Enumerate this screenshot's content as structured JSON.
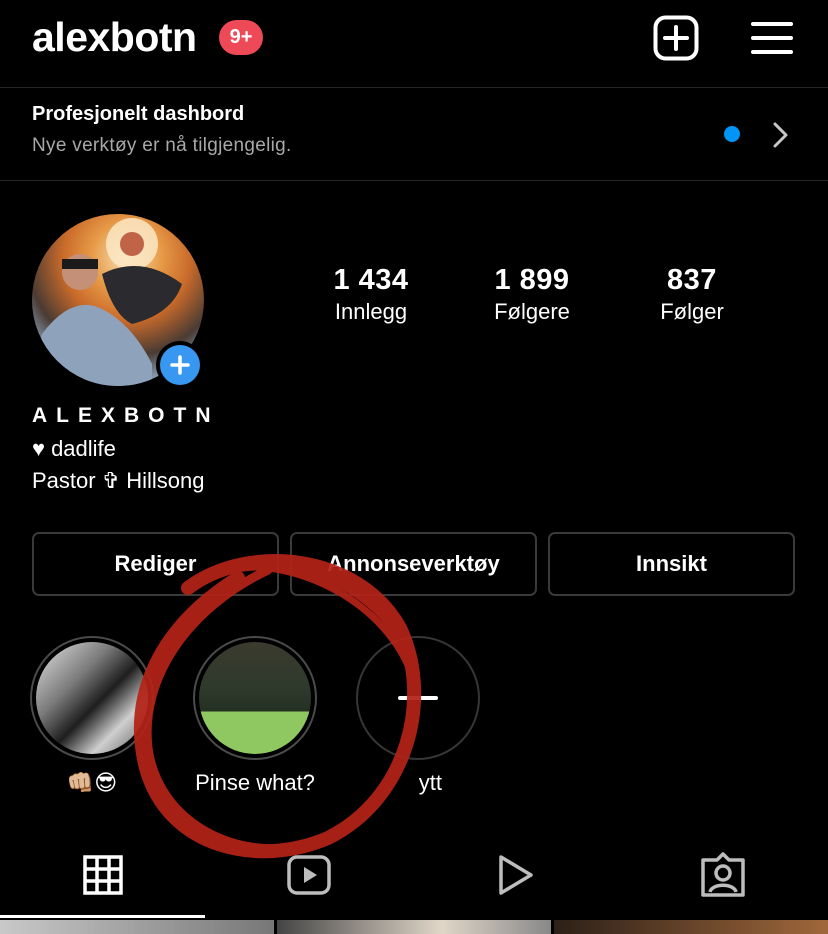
{
  "header": {
    "username": "alexbotn",
    "notification_badge": "9+",
    "icons": [
      "new-post-icon",
      "menu-icon"
    ]
  },
  "dashboard": {
    "title": "Profesjonelt dashbord",
    "subtitle": "Nye verktøy er nå tilgjengelig.",
    "indicator_color": "#0095f6"
  },
  "stats": [
    {
      "value": "1 434",
      "label": "Innlegg"
    },
    {
      "value": "1 899",
      "label": "Følgere"
    },
    {
      "value": "837",
      "label": "Følger"
    }
  ],
  "profile": {
    "display_name": "ALEXBOTN",
    "bio_line1": "dadlife",
    "bio_line2": "Pastor ✞ Hillsong"
  },
  "buttons": {
    "edit": "Rediger",
    "ads": "Annonseverktøy",
    "insights": "Innsikt"
  },
  "highlights": [
    {
      "label": "👊🏼😎"
    },
    {
      "label": "Pinse what?"
    },
    {
      "label": "ytt"
    }
  ],
  "tabs": [
    "grid-icon",
    "reels-icon",
    "video-icon",
    "tagged-icon"
  ],
  "colors": {
    "badge": "#ed4956",
    "accent_blue": "#3897f0",
    "annotation_red": "#b42318"
  }
}
